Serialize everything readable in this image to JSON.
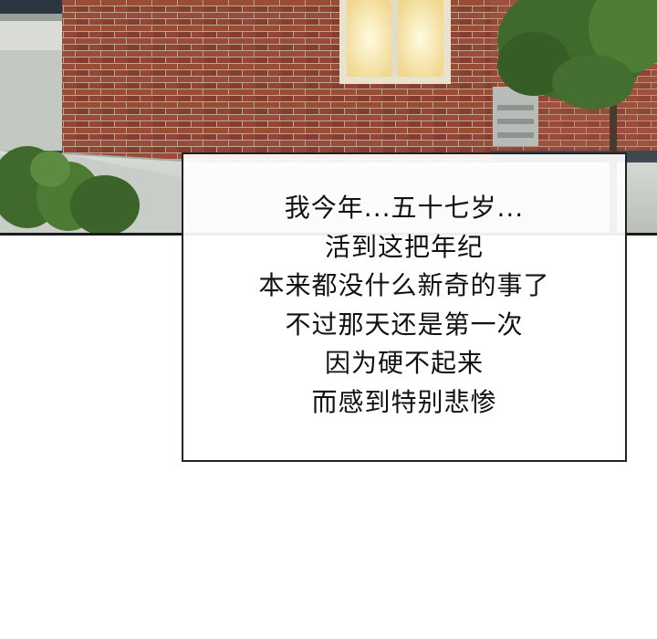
{
  "scene": {
    "description_icon": "brick-house-at-dusk-illustration"
  },
  "caption": {
    "lines": [
      "我今年...五十七岁...",
      "活到这把年纪",
      "本来都没什么新奇的事了",
      "不过那天还是第一次",
      "因为硬不起来",
      "而感到特别悲惨"
    ]
  },
  "colors": {
    "brick": "#9a4a35",
    "mortar": "#c9b7a8",
    "window_glow": "#fff3c4",
    "foliage": "#3f6a2c",
    "border": "#222222"
  }
}
